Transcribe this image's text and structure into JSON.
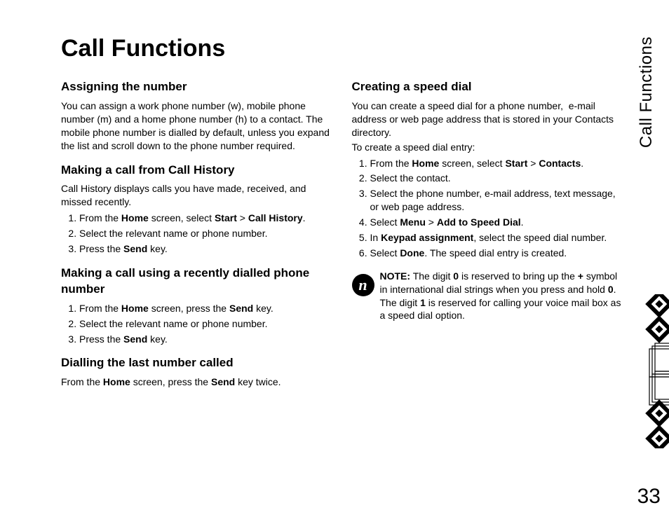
{
  "side_tab": "Call Functions",
  "page_number": "33",
  "title": "Call Functions",
  "left": {
    "s1_h": "Assigning the number",
    "s1_p": "You can assign a work phone number (w), mobile phone number (m) and a home phone number (h) to a contact. The mobile phone number is dialled by default, unless you expand the list and scroll down to the phone number required.",
    "s2_h": "Making a call from Call History",
    "s2_p": "Call History displays calls you have made, received, and missed recently.",
    "s2_li1_a": "From the ",
    "s2_li1_b": "Home",
    "s2_li1_c": " screen, select ",
    "s2_li1_d": "Start",
    "s2_li1_e": " > ",
    "s2_li1_f": "Call History",
    "s2_li1_g": ".",
    "s2_li2": "Select the relevant name or phone number.",
    "s2_li3_a": "Press the ",
    "s2_li3_b": "Send",
    "s2_li3_c": " key.",
    "s3_h": "Making a call using a recently dialled phone number",
    "s3_li1_a": "From the ",
    "s3_li1_b": "Home",
    "s3_li1_c": " screen, press the ",
    "s3_li1_d": "Send",
    "s3_li1_e": " key.",
    "s3_li2": "Select the relevant name or phone number.",
    "s3_li3_a": "Press the ",
    "s3_li3_b": "Send",
    "s3_li3_c": " key.",
    "s4_h": "Dialling the last number called",
    "s4_p_a": "From the ",
    "s4_p_b": "Home",
    "s4_p_c": " screen, press the ",
    "s4_p_d": "Send",
    "s4_p_e": " key twice."
  },
  "right": {
    "s1_h": "Creating a speed dial",
    "s1_p1": "You can create a speed dial for a phone number,  e-mail address or web page address that is stored in your Contacts directory.",
    "s1_p2": "To create a speed dial entry:",
    "li1_a": "From the ",
    "li1_b": "Home",
    "li1_c": " screen, select ",
    "li1_d": "Start",
    "li1_e": " > ",
    "li1_f": "Contacts",
    "li1_g": ".",
    "li2": "Select the contact.",
    "li3": "Select the phone number, e-mail address, text message, or web page address.",
    "li4_a": "Select ",
    "li4_b": "Menu",
    "li4_c": " > ",
    "li4_d": "Add to Speed Dial",
    "li4_e": ".",
    "li5_a": "In ",
    "li5_b": "Keypad assignment",
    "li5_c": ", select the speed dial number.",
    "li6_a": "Select ",
    "li6_b": "Done",
    "li6_c": ". The speed dial entry is created.",
    "note_icon": "n",
    "note_a": "NOTE:",
    "note_b": " The digit ",
    "note_c": "0",
    "note_d": " is reserved to bring up the ",
    "note_e": "+",
    "note_f": " symbol in international dial strings when you press and hold ",
    "note_g": "0",
    "note_h": ". The digit ",
    "note_i": "1",
    "note_j": " is reserved for calling your voice mail box as a speed dial option."
  }
}
